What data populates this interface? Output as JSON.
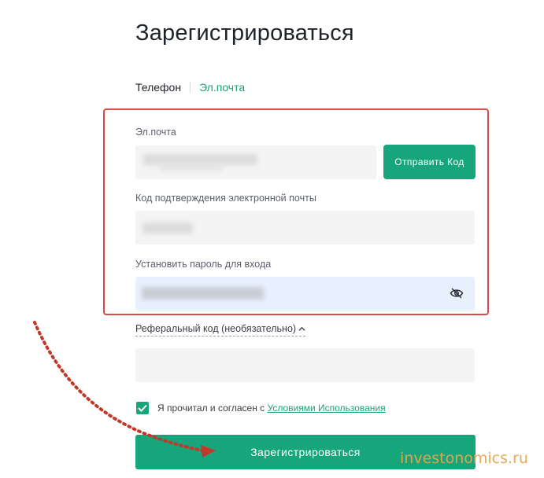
{
  "page": {
    "title": "Зарегистрироваться"
  },
  "tabs": {
    "phone": "Телефон",
    "email": "Эл.почта"
  },
  "form": {
    "email_label": "Эл.почта",
    "send_code_label": "Отправить Код",
    "code_label": "Код подтверждения электронной почты",
    "password_label": "Установить пароль для входа",
    "referral_label": "Реферальный код (необязательно)",
    "agree_text": "Я прочитал и согласен с ",
    "agree_link": "Условиями Использования",
    "agree_checked": true,
    "submit_label": "Зарегистрироваться"
  },
  "icons": {
    "password_toggle": "eye-off-icon",
    "referral_toggle": "chevron-up-icon",
    "checkbox": "checkmark-icon"
  },
  "colors": {
    "accent": "#17a67c",
    "highlight_border": "#d94b45",
    "annotation_arrow": "#c0392b",
    "watermark": "#e8a54b"
  },
  "watermark": {
    "text": "investonomics.ru"
  }
}
